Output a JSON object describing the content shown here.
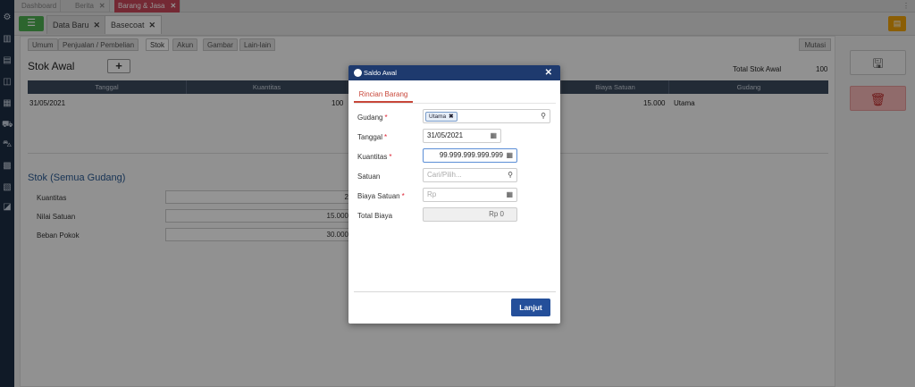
{
  "top_tabs": [
    {
      "label": "Dashboard",
      "closable": false,
      "active": false
    },
    {
      "label": "Berita",
      "closable": true,
      "active": false
    },
    {
      "label": "Barang & Jasa",
      "closable": true,
      "active": true
    }
  ],
  "doc_tabs": [
    {
      "label": "Data Baru",
      "active": false
    },
    {
      "label": "Basecoat",
      "active": true
    }
  ],
  "sub_tabs": [
    "Umum",
    "Penjualan / Pembelian",
    "Stok",
    "Akun",
    "Gambar",
    "Lain-lain"
  ],
  "mutasi_label": "Mutasi",
  "stok_awal": {
    "title": "Stok Awal",
    "add_label": "+",
    "total_label": "Total Stok Awal",
    "total_value": "100",
    "columns": [
      "Tanggal",
      "Kuantitas",
      "",
      "Biaya Satuan",
      "Gudang"
    ],
    "rows": [
      {
        "tanggal": "31/05/2021",
        "kuantitas": "100",
        "biaya_satuan": "15.000",
        "gudang": "Utama"
      }
    ]
  },
  "stok_semua": {
    "title": "Stok (Semua Gudang)",
    "fields": [
      {
        "label": "Kuantitas",
        "value": "2"
      },
      {
        "label": "Nilai Satuan",
        "value": "15.000"
      },
      {
        "label": "Beban Pokok",
        "value": "30.000"
      }
    ]
  },
  "modal": {
    "title": "Saldo Awal",
    "close": "✕",
    "tab": "Rincian Barang",
    "fields": {
      "gudang": {
        "label": "Gudang",
        "chip": "Utama",
        "chip_x": "✖"
      },
      "tanggal": {
        "label": "Tanggal",
        "value": "31/05/2021"
      },
      "kuantitas": {
        "label": "Kuantitas",
        "value": "99.999.999.999.999"
      },
      "satuan": {
        "label": "Satuan",
        "placeholder": "Cari/Pilih..."
      },
      "biaya_satuan": {
        "label": "Biaya Satuan",
        "placeholder": "Rp"
      },
      "total_biaya": {
        "label": "Total Biaya",
        "value": "Rp 0"
      }
    },
    "required_mark": "*",
    "submit": "Lanjut"
  },
  "icons": {
    "menu": "hamburger-icon",
    "save": "floppy-icon",
    "delete": "trash-icon"
  },
  "colors": {
    "sidebar": "#1d2d44",
    "active_tab": "#c8475a",
    "modal_header": "#1e3a6e",
    "primary_button": "#244f9a",
    "required": "#dd2233"
  }
}
